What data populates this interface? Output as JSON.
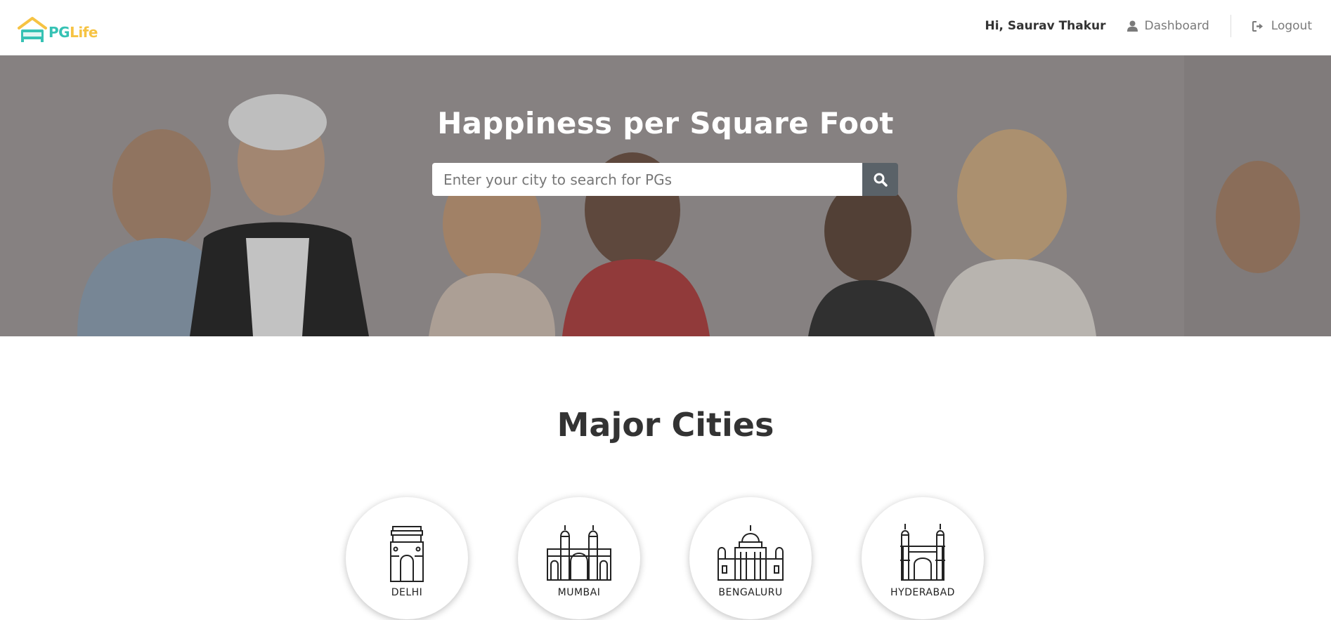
{
  "header": {
    "logo": {
      "pg": "PG",
      "life": "Life"
    },
    "greeting": "Hi, Saurav Thakur",
    "dashboard_label": "Dashboard",
    "logout_label": "Logout"
  },
  "banner": {
    "title": "Happiness per Square Foot",
    "search_placeholder": "Enter your city to search for PGs"
  },
  "cities_section": {
    "title": "Major Cities",
    "cities": [
      {
        "name": "DELHI",
        "icon": "india-gate-icon"
      },
      {
        "name": "MUMBAI",
        "icon": "gateway-of-india-icon"
      },
      {
        "name": "BENGALURU",
        "icon": "vidhana-soudha-icon"
      },
      {
        "name": "HYDERABAD",
        "icon": "charminar-icon"
      }
    ]
  },
  "colors": {
    "brand_teal": "#36c2b4",
    "brand_yellow": "#f6c343",
    "search_button": "#5a6268"
  }
}
